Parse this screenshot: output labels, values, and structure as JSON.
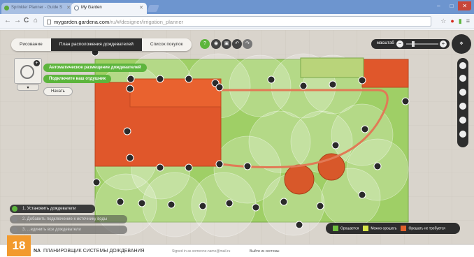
{
  "browser": {
    "tabs": [
      {
        "label": "Sprinkler Planner - Guide S"
      },
      {
        "label": "My Garden"
      }
    ],
    "window_buttons": {
      "minimize": "–",
      "maximize": "□",
      "close": "✕"
    },
    "nav": {
      "back": "←",
      "forward": "→",
      "reload": "C",
      "home": "⌂"
    },
    "url_host": "mygarden.gardena.com",
    "url_path": "/ru/#/designer/irrigation_planner",
    "toolbar_icons": [
      "star-icon",
      "opera-icon",
      "signal-icon",
      "wrench-icon"
    ]
  },
  "app": {
    "top_menu": [
      {
        "label": "Рисование",
        "active": false
      },
      {
        "label": "План расположения дождевателей",
        "active": true
      },
      {
        "label": "Список покупок",
        "active": false
      }
    ],
    "zoom_label": "масштаб",
    "navpad_label": "",
    "left_panel": {
      "badge": "+",
      "toggle": "▾",
      "auto_button": "Автоматическое размещение дождевателей",
      "connect_button": "Подключите ваш отдушник",
      "start_button": "Начать"
    },
    "steps": [
      {
        "label": "1. Установить дождеватели",
        "state": "active"
      },
      {
        "label": "2. Добавить подключение к источнику воды",
        "state": "todo"
      },
      {
        "label": "3. ...единить все дождеватели",
        "state": "todo"
      }
    ],
    "legend": [
      {
        "label": "Орошается",
        "color": "#6fbf3f"
      },
      {
        "label": "Можно орошать",
        "color": "#d7e64a"
      },
      {
        "label": "Орошать не требуется",
        "color": "#e2622c"
      }
    ]
  },
  "overlay_label": "18",
  "footer": {
    "brand": "NA",
    "title": "ПЛАНИРОВЩИК СИСТЕМЫ ДОЖДЕВАНИЯ",
    "signed_in": "Signed in as someone.name@mail.ru",
    "logout": "Выйти из системы"
  }
}
